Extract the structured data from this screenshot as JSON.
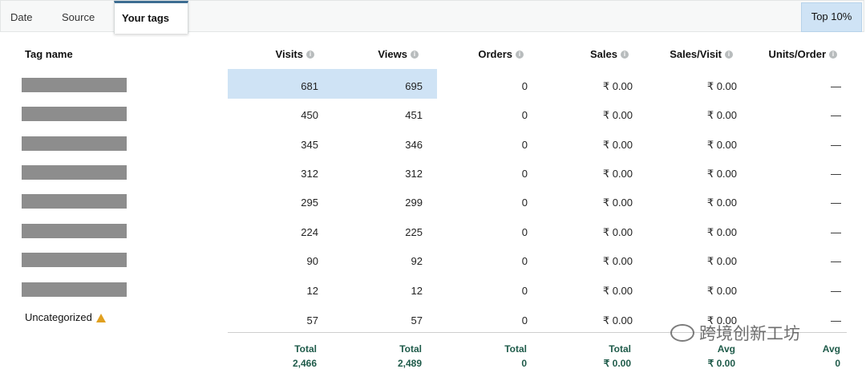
{
  "tabs": [
    {
      "label": "Date",
      "active": false
    },
    {
      "label": "Source",
      "active": false
    },
    {
      "label": "Your tags",
      "active": true
    }
  ],
  "top_filter": {
    "label": "Top 10%"
  },
  "columns": {
    "tag_name": "Tag name",
    "visits": "Visits",
    "views": "Views",
    "orders": "Orders",
    "sales": "Sales",
    "sales_visit": "Sales/Visit",
    "units_order": "Units/Order",
    "info_glyph": "i"
  },
  "rows": [
    {
      "tag": "",
      "visits": "681",
      "views": "695",
      "orders": "0",
      "sales": "₹ 0.00",
      "sales_visit": "₹ 0.00",
      "units_order": "—"
    },
    {
      "tag": "",
      "visits": "450",
      "views": "451",
      "orders": "0",
      "sales": "₹ 0.00",
      "sales_visit": "₹ 0.00",
      "units_order": "—"
    },
    {
      "tag": "",
      "visits": "345",
      "views": "346",
      "orders": "0",
      "sales": "₹ 0.00",
      "sales_visit": "₹ 0.00",
      "units_order": "—"
    },
    {
      "tag": "",
      "visits": "312",
      "views": "312",
      "orders": "0",
      "sales": "₹ 0.00",
      "sales_visit": "₹ 0.00",
      "units_order": "—"
    },
    {
      "tag": "",
      "visits": "295",
      "views": "299",
      "orders": "0",
      "sales": "₹ 0.00",
      "sales_visit": "₹ 0.00",
      "units_order": "—"
    },
    {
      "tag": "",
      "visits": "224",
      "views": "225",
      "orders": "0",
      "sales": "₹ 0.00",
      "sales_visit": "₹ 0.00",
      "units_order": "—"
    },
    {
      "tag": "",
      "visits": "90",
      "views": "92",
      "orders": "0",
      "sales": "₹ 0.00",
      "sales_visit": "₹ 0.00",
      "units_order": "—"
    },
    {
      "tag": "",
      "visits": "12",
      "views": "12",
      "orders": "0",
      "sales": "₹ 0.00",
      "sales_visit": "₹ 0.00",
      "units_order": "—"
    },
    {
      "tag": "Uncategorized",
      "visits": "57",
      "views": "57",
      "orders": "0",
      "sales": "₹ 0.00",
      "sales_visit": "₹ 0.00",
      "units_order": "—"
    }
  ],
  "totals": {
    "visits": {
      "label": "Total",
      "value": "2,466"
    },
    "views": {
      "label": "Total",
      "value": "2,489"
    },
    "orders": {
      "label": "Total",
      "value": "0"
    },
    "sales": {
      "label": "Total",
      "value": "₹ 0.00"
    },
    "sales_visit": {
      "label": "Avg",
      "value": "₹ 0.00"
    },
    "units_order": {
      "label": "Avg",
      "value": "0"
    }
  },
  "watermark": {
    "text": "跨境创新工坊"
  },
  "colors": {
    "highlight": "#cfe3f5",
    "active_tab_border": "#3d6d92",
    "totals_text": "#1f5b4a",
    "redaction": "#8d8d8d"
  }
}
